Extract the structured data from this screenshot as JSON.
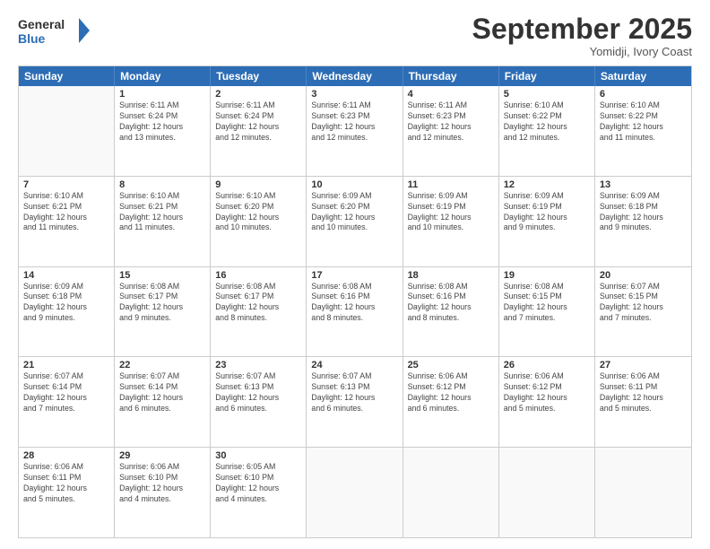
{
  "header": {
    "logo_line1": "General",
    "logo_line2": "Blue",
    "month": "September 2025",
    "location": "Yomidji, Ivory Coast"
  },
  "days_of_week": [
    "Sunday",
    "Monday",
    "Tuesday",
    "Wednesday",
    "Thursday",
    "Friday",
    "Saturday"
  ],
  "weeks": [
    [
      {
        "day": "",
        "info": ""
      },
      {
        "day": "1",
        "info": "Sunrise: 6:11 AM\nSunset: 6:24 PM\nDaylight: 12 hours\nand 13 minutes."
      },
      {
        "day": "2",
        "info": "Sunrise: 6:11 AM\nSunset: 6:24 PM\nDaylight: 12 hours\nand 12 minutes."
      },
      {
        "day": "3",
        "info": "Sunrise: 6:11 AM\nSunset: 6:23 PM\nDaylight: 12 hours\nand 12 minutes."
      },
      {
        "day": "4",
        "info": "Sunrise: 6:11 AM\nSunset: 6:23 PM\nDaylight: 12 hours\nand 12 minutes."
      },
      {
        "day": "5",
        "info": "Sunrise: 6:10 AM\nSunset: 6:22 PM\nDaylight: 12 hours\nand 12 minutes."
      },
      {
        "day": "6",
        "info": "Sunrise: 6:10 AM\nSunset: 6:22 PM\nDaylight: 12 hours\nand 11 minutes."
      }
    ],
    [
      {
        "day": "7",
        "info": "Sunrise: 6:10 AM\nSunset: 6:21 PM\nDaylight: 12 hours\nand 11 minutes."
      },
      {
        "day": "8",
        "info": "Sunrise: 6:10 AM\nSunset: 6:21 PM\nDaylight: 12 hours\nand 11 minutes."
      },
      {
        "day": "9",
        "info": "Sunrise: 6:10 AM\nSunset: 6:20 PM\nDaylight: 12 hours\nand 10 minutes."
      },
      {
        "day": "10",
        "info": "Sunrise: 6:09 AM\nSunset: 6:20 PM\nDaylight: 12 hours\nand 10 minutes."
      },
      {
        "day": "11",
        "info": "Sunrise: 6:09 AM\nSunset: 6:19 PM\nDaylight: 12 hours\nand 10 minutes."
      },
      {
        "day": "12",
        "info": "Sunrise: 6:09 AM\nSunset: 6:19 PM\nDaylight: 12 hours\nand 9 minutes."
      },
      {
        "day": "13",
        "info": "Sunrise: 6:09 AM\nSunset: 6:18 PM\nDaylight: 12 hours\nand 9 minutes."
      }
    ],
    [
      {
        "day": "14",
        "info": "Sunrise: 6:09 AM\nSunset: 6:18 PM\nDaylight: 12 hours\nand 9 minutes."
      },
      {
        "day": "15",
        "info": "Sunrise: 6:08 AM\nSunset: 6:17 PM\nDaylight: 12 hours\nand 9 minutes."
      },
      {
        "day": "16",
        "info": "Sunrise: 6:08 AM\nSunset: 6:17 PM\nDaylight: 12 hours\nand 8 minutes."
      },
      {
        "day": "17",
        "info": "Sunrise: 6:08 AM\nSunset: 6:16 PM\nDaylight: 12 hours\nand 8 minutes."
      },
      {
        "day": "18",
        "info": "Sunrise: 6:08 AM\nSunset: 6:16 PM\nDaylight: 12 hours\nand 8 minutes."
      },
      {
        "day": "19",
        "info": "Sunrise: 6:08 AM\nSunset: 6:15 PM\nDaylight: 12 hours\nand 7 minutes."
      },
      {
        "day": "20",
        "info": "Sunrise: 6:07 AM\nSunset: 6:15 PM\nDaylight: 12 hours\nand 7 minutes."
      }
    ],
    [
      {
        "day": "21",
        "info": "Sunrise: 6:07 AM\nSunset: 6:14 PM\nDaylight: 12 hours\nand 7 minutes."
      },
      {
        "day": "22",
        "info": "Sunrise: 6:07 AM\nSunset: 6:14 PM\nDaylight: 12 hours\nand 6 minutes."
      },
      {
        "day": "23",
        "info": "Sunrise: 6:07 AM\nSunset: 6:13 PM\nDaylight: 12 hours\nand 6 minutes."
      },
      {
        "day": "24",
        "info": "Sunrise: 6:07 AM\nSunset: 6:13 PM\nDaylight: 12 hours\nand 6 minutes."
      },
      {
        "day": "25",
        "info": "Sunrise: 6:06 AM\nSunset: 6:12 PM\nDaylight: 12 hours\nand 6 minutes."
      },
      {
        "day": "26",
        "info": "Sunrise: 6:06 AM\nSunset: 6:12 PM\nDaylight: 12 hours\nand 5 minutes."
      },
      {
        "day": "27",
        "info": "Sunrise: 6:06 AM\nSunset: 6:11 PM\nDaylight: 12 hours\nand 5 minutes."
      }
    ],
    [
      {
        "day": "28",
        "info": "Sunrise: 6:06 AM\nSunset: 6:11 PM\nDaylight: 12 hours\nand 5 minutes."
      },
      {
        "day": "29",
        "info": "Sunrise: 6:06 AM\nSunset: 6:10 PM\nDaylight: 12 hours\nand 4 minutes."
      },
      {
        "day": "30",
        "info": "Sunrise: 6:05 AM\nSunset: 6:10 PM\nDaylight: 12 hours\nand 4 minutes."
      },
      {
        "day": "",
        "info": ""
      },
      {
        "day": "",
        "info": ""
      },
      {
        "day": "",
        "info": ""
      },
      {
        "day": "",
        "info": ""
      }
    ]
  ]
}
